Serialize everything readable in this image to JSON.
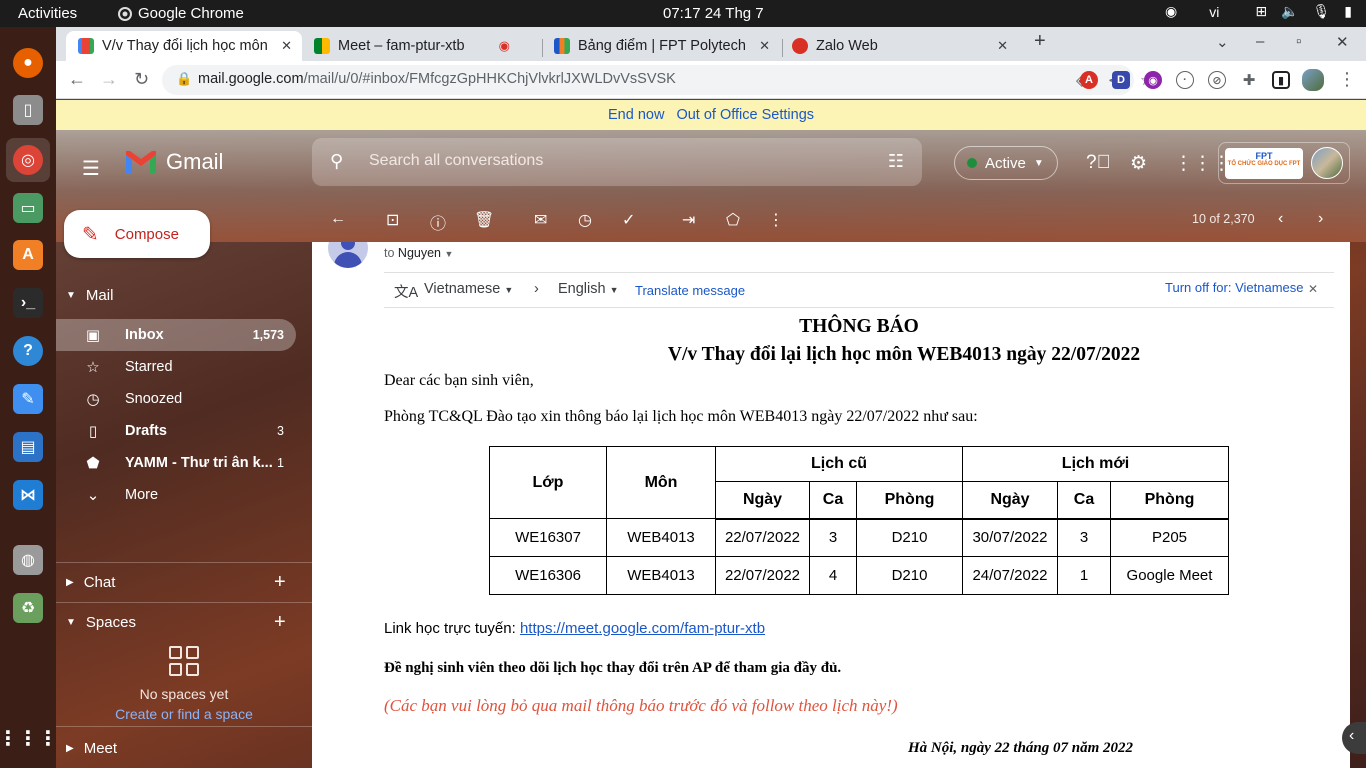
{
  "system": {
    "activities": "Activities",
    "app_name": "Google Chrome",
    "clock": "07:17  24 Thg 7",
    "lang": "vi"
  },
  "tabs": [
    {
      "title": "V/v Thay đổi lịch học môn",
      "icon": "gmail-icon"
    },
    {
      "title": "Meet – fam-ptur-xtb",
      "icon": "meet-icon"
    },
    {
      "title": "Bảng điểm | FPT Polytech",
      "icon": "fpt-icon"
    },
    {
      "title": "Zalo Web",
      "icon": "zalo-icon"
    }
  ],
  "address": {
    "host": "mail.google.com",
    "path": "/mail/u/0/#inbox/FMfcgzGpHHKChjVlvkrlJXWLDvVsSVSK"
  },
  "ooo_banner": {
    "end_now": "End now",
    "settings": "Out of Office Settings"
  },
  "gmail": {
    "logo": "Gmail",
    "search_placeholder": "Search all conversations",
    "status": "Active",
    "org_badge_name": "FPT",
    "org_badge_sub": "TỔ CHỨC GIÁO DỤC FPT",
    "compose": "Compose",
    "mail_title": "Mail",
    "nav": [
      {
        "label": "Inbox",
        "count": "1,573",
        "icon": "inbox-icon"
      },
      {
        "label": "Starred",
        "count": "",
        "icon": "star-icon"
      },
      {
        "label": "Snoozed",
        "count": "",
        "icon": "clock-icon"
      },
      {
        "label": "Drafts",
        "count": "3",
        "icon": "draft-icon"
      },
      {
        "label": "YAMM - Thư tri ân k...",
        "count": "1",
        "icon": "label-icon"
      },
      {
        "label": "More",
        "count": "",
        "icon": "chevron-down-icon"
      }
    ],
    "chat_title": "Chat",
    "spaces_title": "Spaces",
    "no_spaces": "No spaces yet",
    "create_space": "Create or find a space",
    "meet_title": "Meet",
    "pager": "10 of 2,370"
  },
  "message": {
    "to_prefix": "to",
    "to_name": "Nguyen",
    "translate": {
      "from_lang": "Vietnamese",
      "to_lang": "English",
      "translate_link": "Translate message",
      "turn_off": "Turn off for: Vietnamese"
    },
    "heading": "THÔNG BÁO",
    "subject": "V/v Thay đổi lại lịch học môn WEB4013 ngày 22/07/2022",
    "greeting": "Dear các bạn sinh viên,",
    "intro": "Phòng TC&QL Đào tạo xin thông báo lại lịch học môn WEB4013 ngày 22/07/2022 như sau:",
    "table": {
      "col_class": "Lớp",
      "col_subject": "Môn",
      "group_old": "Lịch cũ",
      "group_new": "Lịch mới",
      "sub_date": "Ngày",
      "sub_slot": "Ca",
      "sub_room": "Phòng",
      "rows": [
        {
          "cls": "WE16307",
          "subj": "WEB4013",
          "old_date": "22/07/2022",
          "old_slot": "3",
          "old_room": "D210",
          "new_date": "30/07/2022",
          "new_slot": "3",
          "new_room": "P205"
        },
        {
          "cls": "WE16306",
          "subj": "WEB4013",
          "old_date": "22/07/2022",
          "old_slot": "4",
          "old_room": "D210",
          "new_date": "24/07/2022",
          "new_slot": "1",
          "new_room": "Google Meet"
        }
      ]
    },
    "link_label": "Link học trực tuyến: ",
    "link_url": "https://meet.google.com/fam-ptur-xtb",
    "advice": "Đề nghị sinh viên theo dõi lịch học thay đổi trên AP để tham gia đầy đủ.",
    "ignore_note": "(Các bạn vui lòng bỏ qua mail thông báo trước đó và follow theo lịch này!)",
    "signature_date": "Hà Nội, ngày 22 tháng 07 năm 2022"
  },
  "colors": {
    "accent": "#c5221f",
    "link": "#1a57c9",
    "banner": "#fcf4b4",
    "note_red": "#e0533d"
  }
}
